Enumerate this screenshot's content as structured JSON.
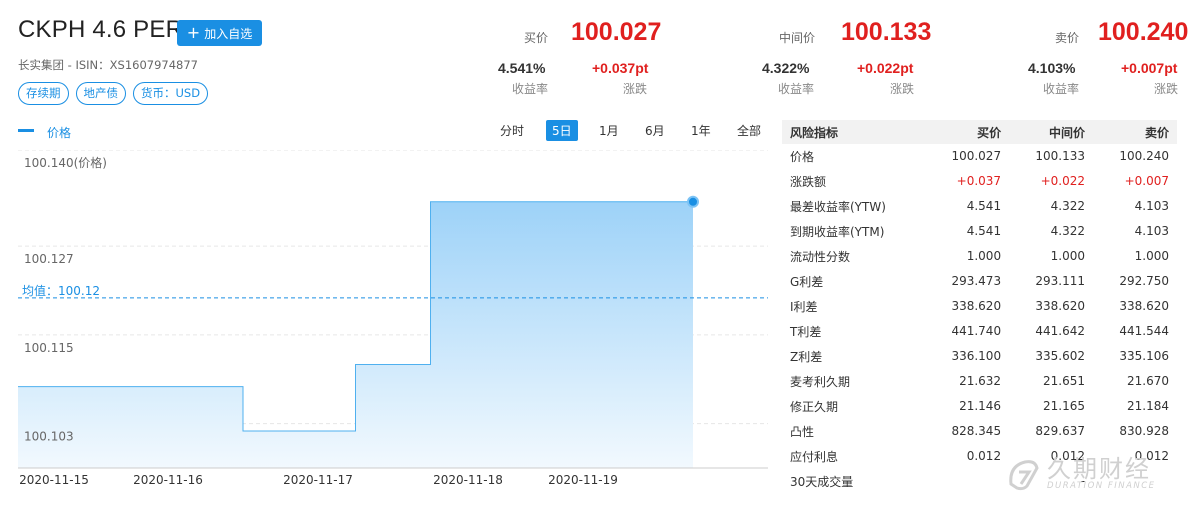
{
  "header": {
    "title": "CKPH 4.6 PERP",
    "add_watch_label": "加入自选",
    "issuer_line": "长实集团 - ISIN：XS1607974877",
    "tags": [
      "存续期",
      "地产债",
      "货币：USD"
    ]
  },
  "quotes": [
    {
      "label": "买价",
      "price": "100.027",
      "yield": "4.541%",
      "yield_label": "收益率",
      "change": "+0.037pt",
      "change_label": "涨跌"
    },
    {
      "label": "中间价",
      "price": "100.133",
      "yield": "4.322%",
      "yield_label": "收益率",
      "change": "+0.022pt",
      "change_label": "涨跌"
    },
    {
      "label": "卖价",
      "price": "100.240",
      "yield": "4.103%",
      "yield_label": "收益率",
      "change": "+0.007pt",
      "change_label": "涨跌"
    }
  ],
  "legend": {
    "series_name": "价格"
  },
  "ranges": [
    "分时",
    "5日",
    "1月",
    "6月",
    "1年",
    "全部"
  ],
  "active_range": "5日",
  "chart_data": {
    "type": "area",
    "step": true,
    "series": [
      {
        "name": "价格",
        "color": "#1a8fe3"
      }
    ],
    "points": [
      {
        "x": "2020-11-15",
        "y": 100.108
      },
      {
        "x": "2020-11-16 12:00",
        "y": 100.108
      },
      {
        "x": "2020-11-16 12:00",
        "y": 100.102
      },
      {
        "x": "2020-11-17 06:00",
        "y": 100.102
      },
      {
        "x": "2020-11-17 06:00",
        "y": 100.111
      },
      {
        "x": "2020-11-17 18:00",
        "y": 100.111
      },
      {
        "x": "2020-11-17 18:00",
        "y": 100.133
      },
      {
        "x": "2020-11-19 12:00",
        "y": 100.133
      }
    ],
    "y_ticks": [
      "100.140(价格)",
      "100.127",
      "100.115",
      "100.103"
    ],
    "x_ticks": [
      "2020-11-15",
      "2020-11-16",
      "2020-11-17",
      "2020-11-18",
      "2020-11-19"
    ],
    "ylim": [
      100.097,
      100.14
    ],
    "mean_label": "均值：100.12",
    "mean_value": 100.12,
    "grid": true
  },
  "risk_table": {
    "headers": [
      "风险指标",
      "买价",
      "中间价",
      "卖价"
    ],
    "rows": [
      {
        "name": "价格",
        "values": [
          "100.027",
          "100.133",
          "100.240"
        ],
        "red": false,
        "sep": false
      },
      {
        "name": "涨跌额",
        "values": [
          "+0.037",
          "+0.022",
          "+0.007"
        ],
        "red": true,
        "sep": false
      },
      {
        "name": "最差收益率(YTW)",
        "values": [
          "4.541",
          "4.322",
          "4.103"
        ],
        "red": false,
        "sep": false
      },
      {
        "name": "到期收益率(YTM)",
        "values": [
          "4.541",
          "4.322",
          "4.103"
        ],
        "red": false,
        "sep": false
      },
      {
        "name": "流动性分数",
        "values": [
          "1.000",
          "1.000",
          "1.000"
        ],
        "red": false,
        "sep": false
      },
      {
        "name": "G利差",
        "values": [
          "293.473",
          "293.111",
          "292.750"
        ],
        "red": false,
        "sep": false
      },
      {
        "name": "I利差",
        "values": [
          "338.620",
          "338.620",
          "338.620"
        ],
        "red": false,
        "sep": false
      },
      {
        "name": "T利差",
        "values": [
          "441.740",
          "441.642",
          "441.544"
        ],
        "red": false,
        "sep": false
      },
      {
        "name": "Z利差",
        "values": [
          "336.100",
          "335.602",
          "335.106"
        ],
        "red": false,
        "sep": false
      },
      {
        "name": "麦考利久期",
        "values": [
          "21.632",
          "21.651",
          "21.670"
        ],
        "red": false,
        "sep": false
      },
      {
        "name": "修正久期",
        "values": [
          "21.146",
          "21.165",
          "21.184"
        ],
        "red": false,
        "sep": false
      },
      {
        "name": "凸性",
        "values": [
          "828.345",
          "829.637",
          "830.928"
        ],
        "red": false,
        "sep": false
      },
      {
        "name": "应付利息",
        "values": [
          "0.012",
          "0.012",
          "0.012"
        ],
        "red": false,
        "sep": true
      },
      {
        "name": "30天成交量",
        "values": [
          "",
          "-",
          ""
        ],
        "red": false,
        "sep": false
      }
    ]
  },
  "watermark": {
    "name": "久期财经",
    "sub": "DURATION FINANCE"
  }
}
